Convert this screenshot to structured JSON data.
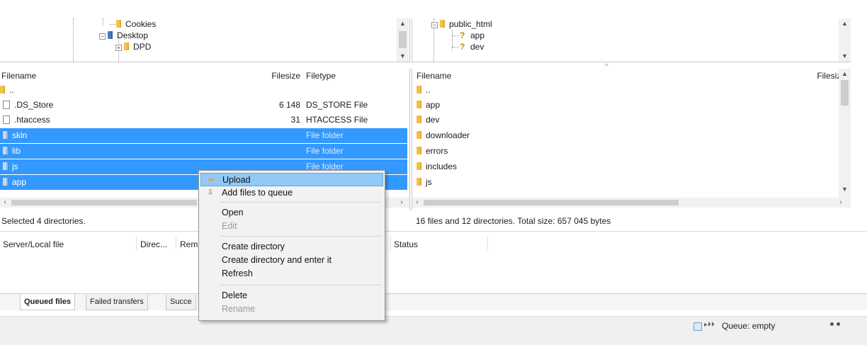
{
  "local_tree": {
    "items": [
      {
        "label": "Cookies"
      },
      {
        "label": "Desktop"
      },
      {
        "label": "DPD"
      }
    ]
  },
  "remote_tree": {
    "items": [
      {
        "label": "public_html"
      },
      {
        "label": "app"
      },
      {
        "label": "dev"
      }
    ]
  },
  "local_list": {
    "headers": {
      "filename": "Filename",
      "filesize": "Filesize",
      "filetype": "Filetype"
    },
    "rows": [
      {
        "name": "..",
        "size": "",
        "type": "",
        "icon": "folder-icon"
      },
      {
        "name": ".DS_Store",
        "size": "6 148",
        "type": "DS_STORE File",
        "icon": "file-icon"
      },
      {
        "name": ".htaccess",
        "size": "31",
        "type": "HTACCESS File",
        "icon": "file-icon"
      },
      {
        "name": "skin",
        "size": "",
        "type": "File folder",
        "icon": "folder-icon"
      },
      {
        "name": "lib",
        "size": "",
        "type": "File folder",
        "icon": "folder-icon"
      },
      {
        "name": "js",
        "size": "",
        "type": "File folder",
        "icon": "folder-icon"
      },
      {
        "name": "app",
        "size": "",
        "type": "",
        "icon": "folder-icon"
      }
    ],
    "status": "Selected 4 directories."
  },
  "remote_list": {
    "headers": {
      "filename": "Filename",
      "filesize": "Filesize"
    },
    "rows": [
      {
        "name": "..",
        "icon": "folder-icon"
      },
      {
        "name": "app",
        "icon": "folder-icon"
      },
      {
        "name": "dev",
        "icon": "folder-icon"
      },
      {
        "name": "downloader",
        "icon": "folder-icon"
      },
      {
        "name": "errors",
        "icon": "folder-icon"
      },
      {
        "name": "includes",
        "icon": "folder-icon"
      },
      {
        "name": "js",
        "icon": "folder-icon"
      }
    ],
    "status": "16 files and 12 directories. Total size: 657 045 bytes"
  },
  "queue": {
    "headers": {
      "server_local_file": "Server/Local file",
      "direction": "Direc...",
      "remote": "Rem",
      "status": "Status"
    },
    "tabs": [
      "Queued files",
      "Failed transfers",
      "Succe"
    ]
  },
  "context_menu": {
    "items": [
      {
        "label": "Upload",
        "icon": "upload-arrow-icon",
        "highlighted": true
      },
      {
        "label": "Add files to queue",
        "icon": "add-to-queue-icon"
      },
      {
        "label": "Open"
      },
      {
        "label": "Edit",
        "disabled": true
      },
      {
        "label": "Create directory"
      },
      {
        "label": "Create directory and enter it"
      },
      {
        "label": "Refresh"
      },
      {
        "label": "Delete"
      },
      {
        "label": "Rename",
        "disabled": true
      }
    ]
  },
  "statusbar": {
    "queue_text": "Queue: empty",
    "queue_icon": "queue-icon"
  },
  "colors": {
    "selection": "#3399ff",
    "menu_highlight": "#91c9f7",
    "folder": "#f2c14e"
  }
}
